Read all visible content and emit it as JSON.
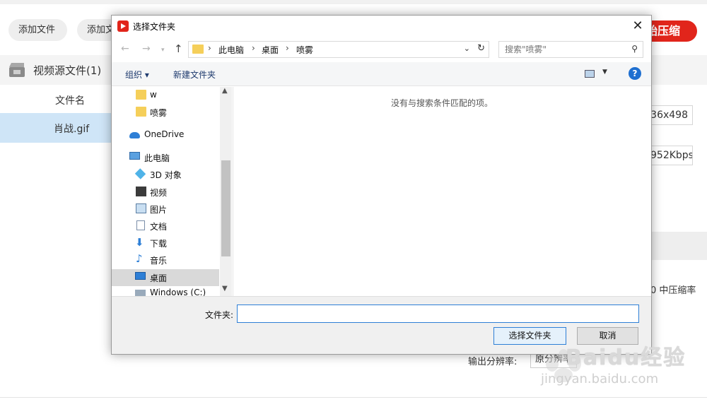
{
  "app": {
    "add_file": "添加文件",
    "add_folder": "添加文",
    "compress": "始压缩",
    "section_title": "视频源文件(1)",
    "col_filename": "文件名",
    "file_name": "肖战.gif",
    "resolution": "36x498",
    "bitrate": "952Kbps",
    "compress_level": "0  中压缩率",
    "output_resolution_label": "输出分辨率:",
    "output_resolution_value": "原分辨率"
  },
  "dialog": {
    "title": "选择文件夹",
    "close": "✕",
    "nav": {
      "back": "←",
      "forward": "→",
      "recent": "▾",
      "up": "↑"
    },
    "breadcrumbs": [
      "此电脑",
      "桌面",
      "喷雾"
    ],
    "search_placeholder": "搜索\"喷雾\"",
    "toolbar": {
      "organize": "组织 ▾",
      "new_folder": "新建文件夹",
      "help": "?"
    },
    "tree": [
      {
        "label": "w",
        "icon": "folder-icon"
      },
      {
        "label": "喷雾",
        "icon": "folder-icon"
      },
      {
        "label": "OneDrive",
        "icon": "cloud-icon"
      },
      {
        "label": "此电脑",
        "icon": "pc-icon"
      },
      {
        "label": "3D 对象",
        "icon": "cube-icon"
      },
      {
        "label": "视频",
        "icon": "video-icon"
      },
      {
        "label": "图片",
        "icon": "picture-icon"
      },
      {
        "label": "文档",
        "icon": "document-icon"
      },
      {
        "label": "下载",
        "icon": "download-icon"
      },
      {
        "label": "音乐",
        "icon": "music-icon"
      },
      {
        "label": "桌面",
        "icon": "desktop-icon"
      },
      {
        "label": "Windows (C:)",
        "icon": "drive-icon"
      }
    ],
    "empty_message": "没有与搜索条件匹配的项。",
    "folder_label": "文件夹:",
    "folder_value": "",
    "select_button": "选择文件夹",
    "cancel_button": "取消"
  },
  "watermark": {
    "text": "Baidu经验",
    "sub": "jingyan.baidu.com"
  }
}
